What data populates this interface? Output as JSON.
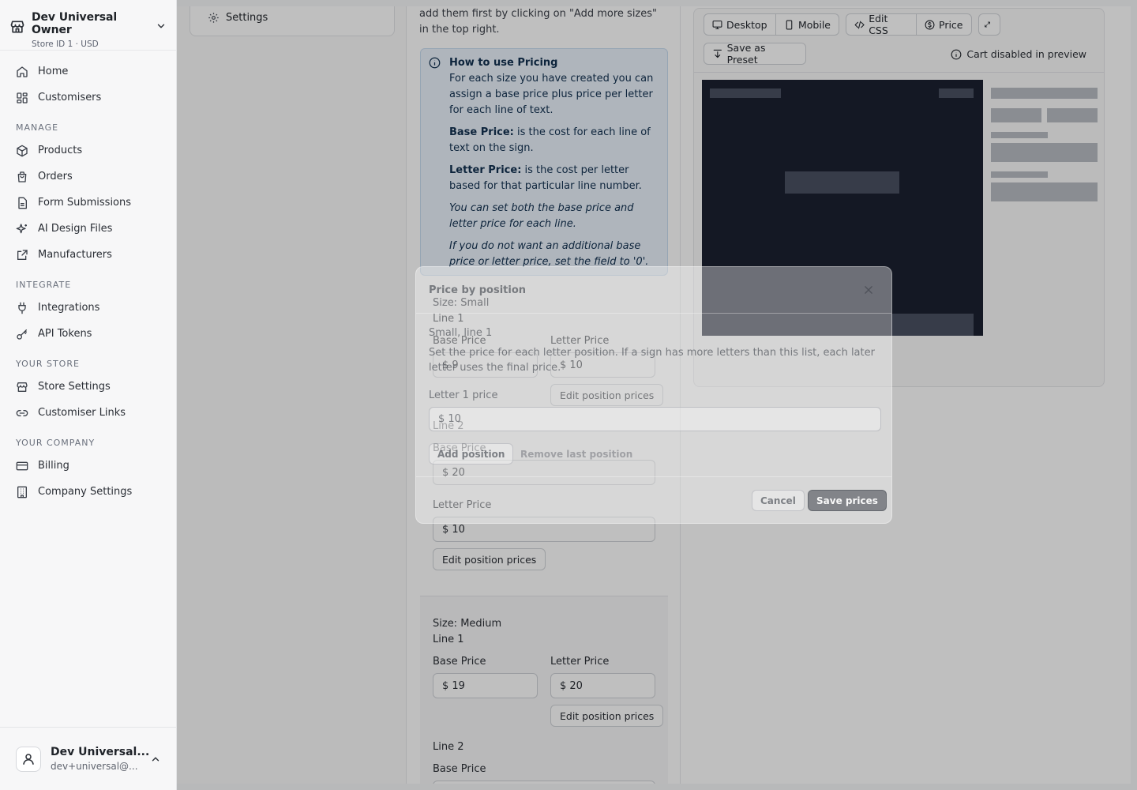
{
  "store": {
    "name": "Dev Universal Owner",
    "meta": "Store ID 1 · USD"
  },
  "nav": {
    "top": [
      {
        "label": "Home",
        "icon": "home-icon"
      },
      {
        "label": "Customisers",
        "icon": "grid-icon"
      }
    ],
    "groups": [
      {
        "title": "MANAGE",
        "items": [
          {
            "label": "Products",
            "icon": "box-icon"
          },
          {
            "label": "Orders",
            "icon": "bag-icon"
          },
          {
            "label": "Form Submissions",
            "icon": "file-icon"
          },
          {
            "label": "AI Design Files",
            "icon": "sparkles-icon"
          },
          {
            "label": "Manufacturers",
            "icon": "external-link-icon"
          }
        ]
      },
      {
        "title": "INTEGRATE",
        "items": [
          {
            "label": "Integrations",
            "icon": "plug-icon"
          },
          {
            "label": "API Tokens",
            "icon": "key-icon"
          }
        ]
      },
      {
        "title": "YOUR STORE",
        "items": [
          {
            "label": "Store Settings",
            "icon": "store-icon"
          },
          {
            "label": "Customiser Links",
            "icon": "link-icon"
          }
        ]
      },
      {
        "title": "YOUR COMPANY",
        "items": [
          {
            "label": "Billing",
            "icon": "card-icon"
          },
          {
            "label": "Company Settings",
            "icon": "building-icon"
          }
        ]
      }
    ]
  },
  "user": {
    "name": "Dev Universal...",
    "email": "dev+universal@..."
  },
  "left_panel": {
    "settings_label": "Settings"
  },
  "mid": {
    "intro": "add them first by clicking on \"Add more sizes\" in the top right.",
    "info": {
      "title": "How to use Pricing",
      "p1": "For each size you have created you can assign a base price plus price per letter for each line of text.",
      "base_title": "Base Price:",
      "base_text": " is the cost for each line of text on the sign.",
      "letter_title": "Letter Price:",
      "letter_text": " is the cost per letter based for that particular line number.",
      "note1": "You can set both the base price and letter price for each line.",
      "note2": "If you do not want an additional base price or letter price, set the field to '0'."
    },
    "small": {
      "size": "Size: Small",
      "line1": "Line 1",
      "line1_base_label": "Base Price",
      "line1_base_value": "$ 9",
      "line1_letter_label": "Letter Price",
      "line1_letter_value": "$ 10",
      "line1_edit": "Edit position prices",
      "line2": "Line 2",
      "line2_base_label": "Base Price",
      "line2_base_value": "$ 20",
      "line2_letter_label": "Letter Price",
      "line2_letter_value": "$ 10",
      "line2_edit": "Edit position prices"
    },
    "medium": {
      "size": "Size: Medium",
      "line1": "Line 1",
      "base_label": "Base Price",
      "base_value": "$ 19",
      "letter_label": "Letter Price",
      "letter_value": "$ 20",
      "edit": "Edit position prices",
      "line2": "Line 2",
      "line2_base_label": "Base Price"
    }
  },
  "toolbar": {
    "desktop": "Desktop",
    "mobile": "Mobile",
    "edit_css": "Edit CSS",
    "price": "Price",
    "save_preset": "Save as Preset",
    "cart_note": "Cart disabled in preview"
  },
  "modal": {
    "title": "Price by position",
    "subtitle": "Small, line 1",
    "description": "Set the price for each letter position. If a sign has more letters than this list, each later letter uses the final price.",
    "field_label": "Letter 1 price",
    "field_value": "$ 10",
    "add": "Add position",
    "remove": "Remove last position",
    "cancel": "Cancel",
    "save": "Save prices"
  },
  "colors": {
    "preview_dark": "#1b2030",
    "info_bg": "#eaf2fb",
    "accent_dark": "#3c4048"
  }
}
